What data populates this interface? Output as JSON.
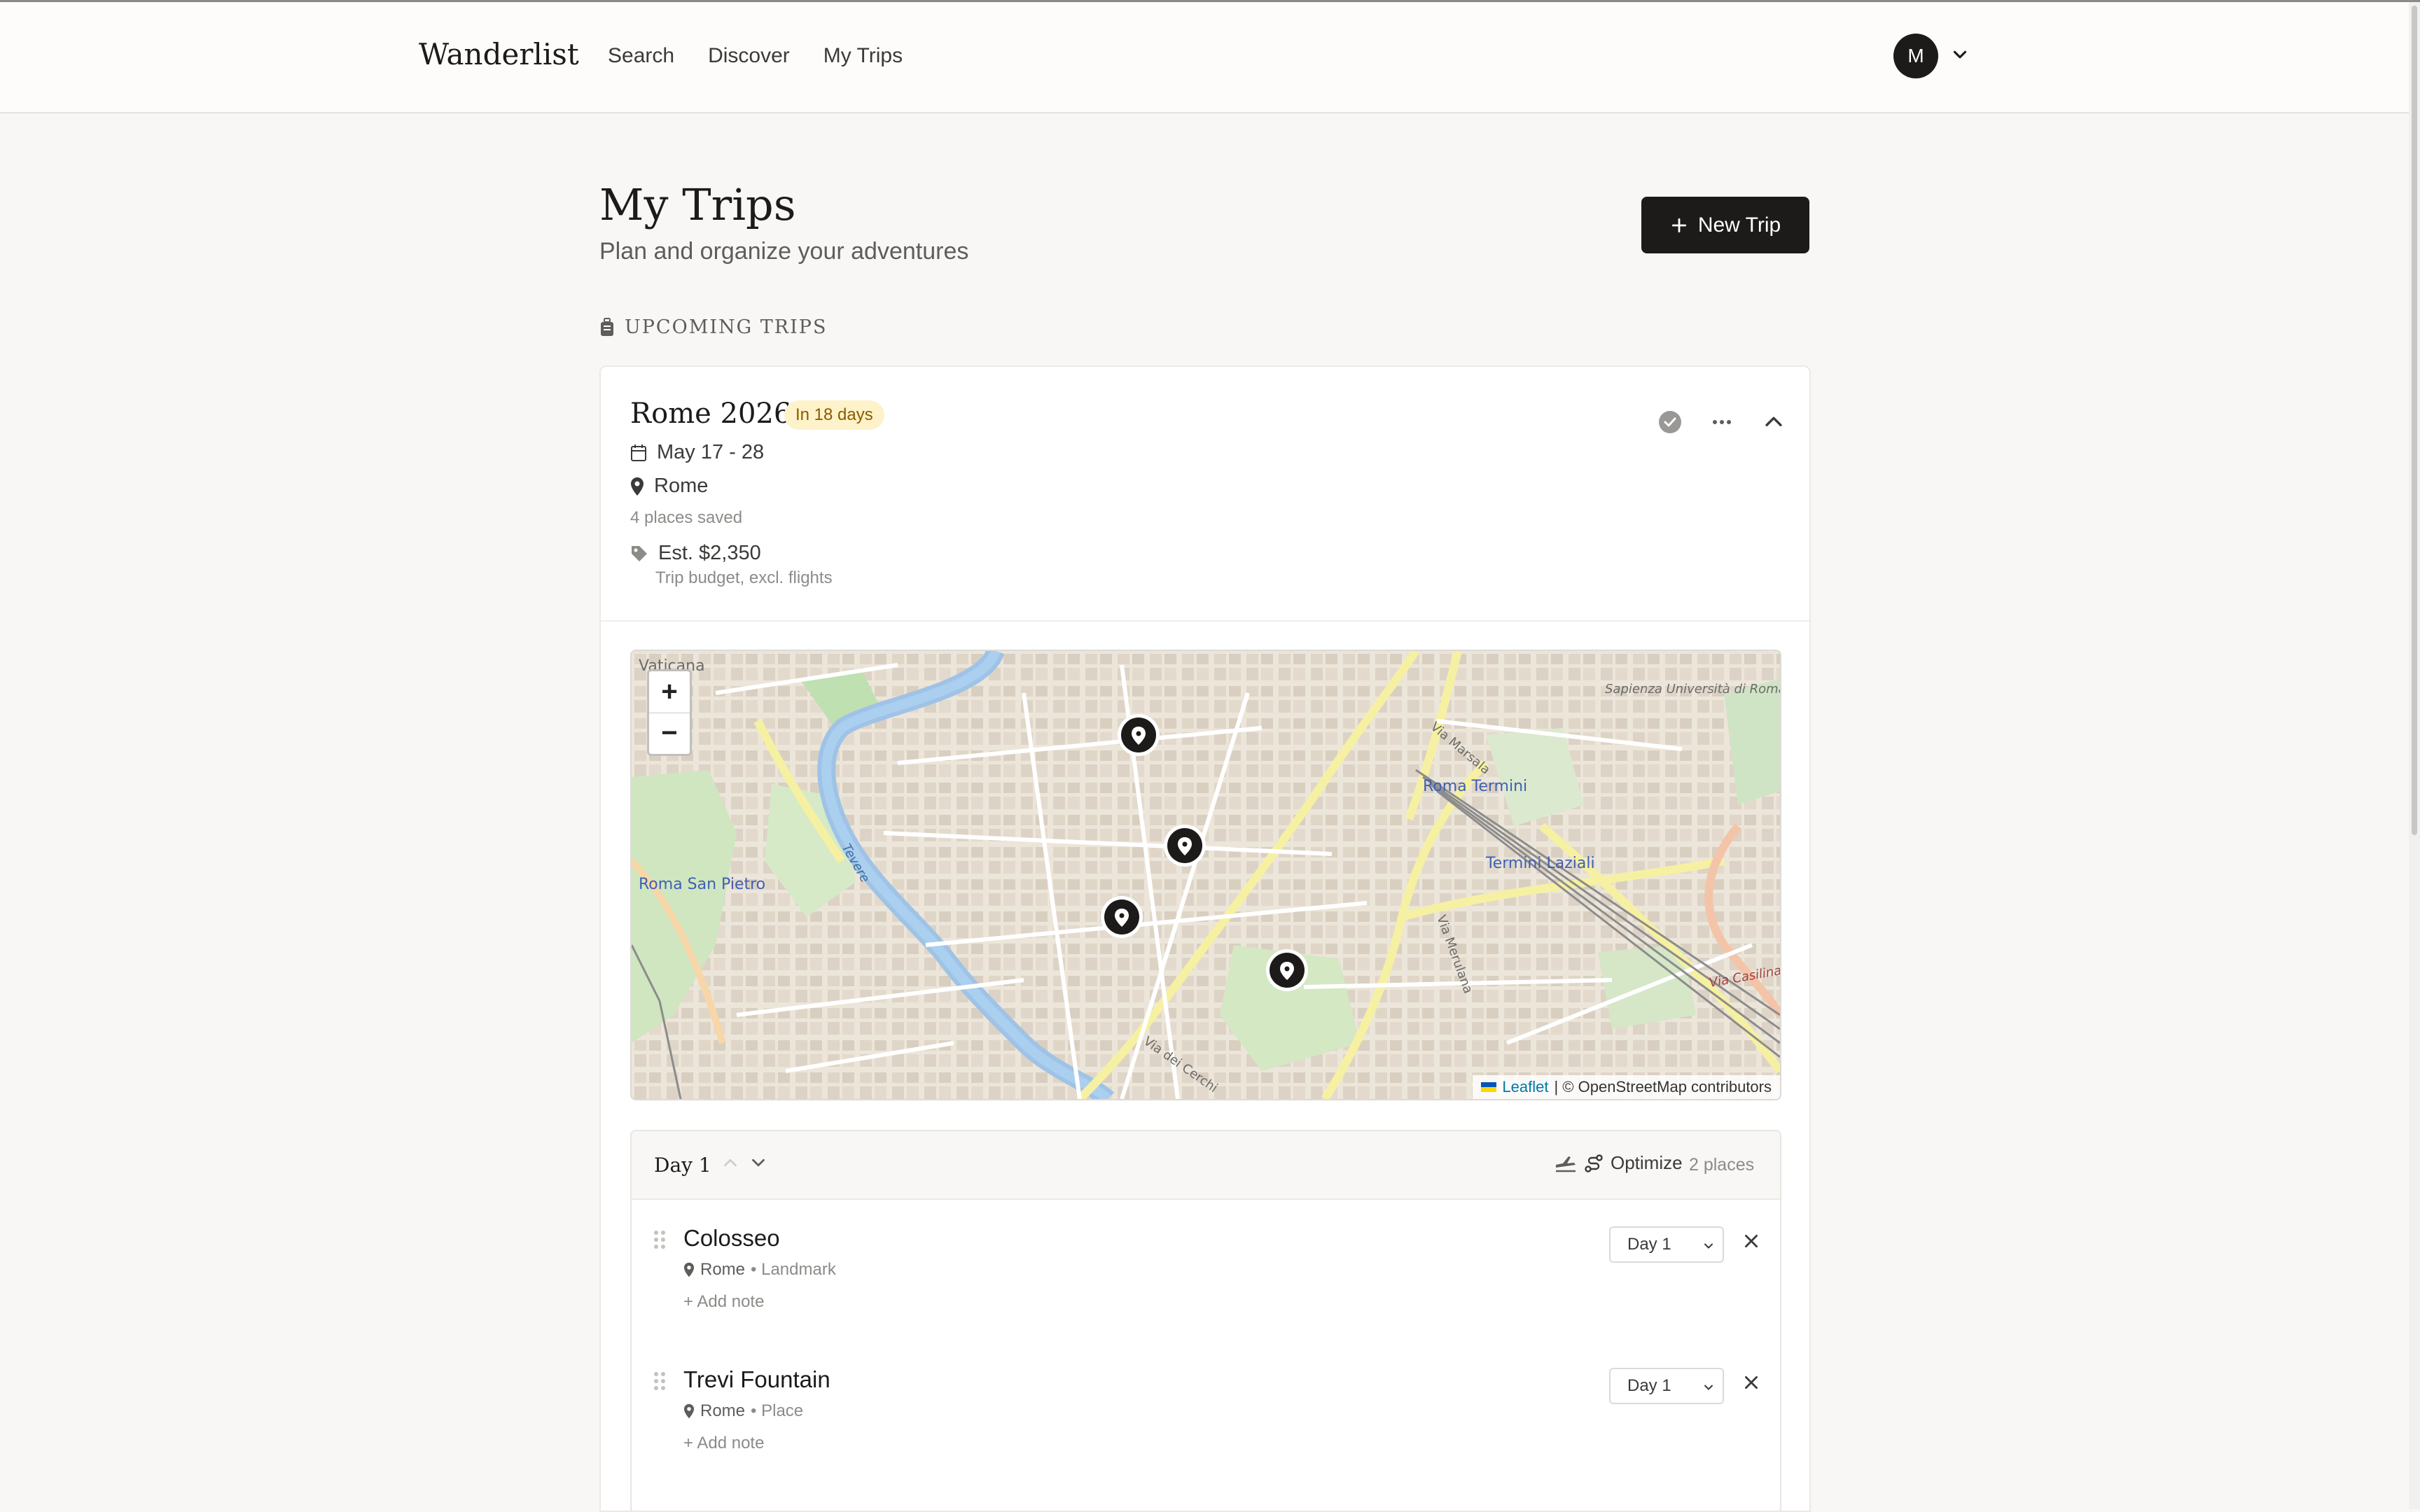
{
  "app": {
    "brand": "Wanderlist"
  },
  "nav": {
    "items": [
      "Search",
      "Discover",
      "My Trips"
    ]
  },
  "user": {
    "initial": "M"
  },
  "page": {
    "title": "My Trips",
    "subtitle": "Plan and organize your adventures",
    "new_trip_label": "New Trip",
    "section_label": "UPCOMING TRIPS"
  },
  "trip": {
    "name": "Rome 2026",
    "badge": "In 18 days",
    "dates": "May 17 - 28",
    "location": "Rome",
    "places_saved": "4 places saved",
    "budget": "Est. $2,350",
    "budget_note": "Trip budget, excl. flights"
  },
  "map": {
    "zoom_in": "+",
    "zoom_out": "−",
    "attribution_link": "Leaflet",
    "attribution_text": "| © OpenStreetMap contributors",
    "labels": [
      "Vaticana",
      "Roma San Pietro",
      "Roma Termini",
      "Termini Laziali",
      "Sapienza Università di Roma",
      "Via Marsala",
      "Via Merulana",
      "Via dei Cerchi",
      "Tevere",
      "Via Casilina"
    ]
  },
  "day": {
    "title": "Day 1",
    "optimize_label": "Optimize",
    "count": "2 places",
    "places": [
      {
        "name": "Colosseo",
        "city": "Rome",
        "category": "• Landmark",
        "add_note": "+ Add note",
        "day": "Day 1"
      },
      {
        "name": "Trevi Fountain",
        "city": "Rome",
        "category": "• Place",
        "add_note": "+ Add note",
        "day": "Day 1"
      }
    ]
  },
  "colors": {
    "accent": "#1c1b1a",
    "badge_bg": "#fdf2c9",
    "badge_text": "#8a5b00",
    "background": "#f8f7f5"
  }
}
